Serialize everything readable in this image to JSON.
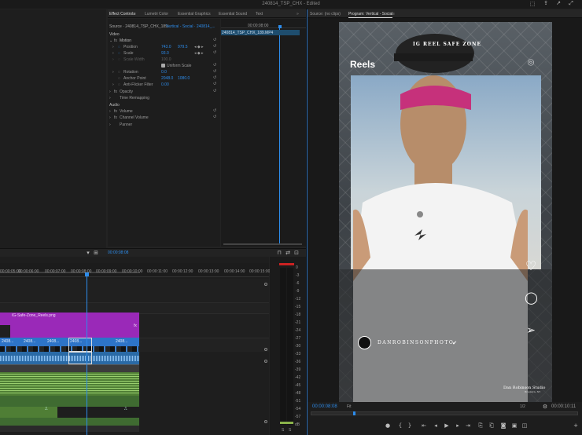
{
  "titlebar": {
    "title": "240814_TSP_CHX - Edited"
  },
  "tabs": [
    {
      "label": "Effect Controls",
      "active": true
    },
    {
      "label": "Lumetri Color"
    },
    {
      "label": "Essential Graphics"
    },
    {
      "label": "Essential Sound"
    },
    {
      "label": "Text"
    }
  ],
  "effect_controls": {
    "source_label": "Source · 240814_TSP_CHX_189...",
    "sequence_label": "Vertical - Social · 240814_...",
    "timecode_head": "00:00:08:00",
    "clip_bar_label": "240814_TSP_CHX_189.MP4",
    "video_header": "Video",
    "motion_label": "Motion",
    "position_label": "Position",
    "position_x": "743.0",
    "position_y": "979.5",
    "scale_label": "Scale",
    "scale_value": "93.0",
    "scale_width_label": "Scale Width",
    "scale_width_value": "100.0",
    "uniform_scale_label": "Uniform Scale",
    "rotation_label": "Rotation",
    "rotation_value": "0.0",
    "anchor_label": "Anchor Point",
    "anchor_x": "2048.0",
    "anchor_y": "1080.0",
    "antiflicker_label": "Anti-Flicker Filter",
    "antiflicker_value": "0.00",
    "opacity_label": "Opacity",
    "time_remap_label": "Time Remapping",
    "audio_header": "Audio",
    "volume_label": "Volume",
    "channel_volume_label": "Channel Volume",
    "panner_label": "Panner",
    "current_timecode": "00:00:08:08"
  },
  "timeline": {
    "ruler": [
      "00:00:05:00",
      "00:00:06:00",
      "00:00:07:00",
      "00:00:08:00",
      "00:00:09:00",
      "00:00:10:00",
      "00:00:11:00",
      "00:00:12:00",
      "00:00:13:00",
      "00:00:14:00",
      "00:00:15:00"
    ],
    "graphic_clip_label": "IG-Safe-Zone_Reels.png",
    "video_clips": [
      "2408...",
      "2408...",
      "2408...",
      "2408...",
      "2408..."
    ]
  },
  "meter": {
    "scale": [
      "0",
      "-3",
      "-6",
      "-9",
      "-12",
      "-15",
      "-18",
      "-21",
      "-24",
      "-27",
      "-30",
      "-33",
      "-36",
      "-39",
      "-42",
      "-45",
      "-48",
      "-51",
      "-54",
      "-57",
      "dB"
    ],
    "solo": [
      "S",
      "S"
    ]
  },
  "monitor": {
    "source_tab": "Source: (no clips)",
    "program_tab": "Program: Vertical - Social",
    "current_timecode": "00:00:08:08",
    "fit_label": "Fit",
    "quality_label": "1/2",
    "duration": "00:00:10:11"
  },
  "overlay": {
    "safe_zone_title": "IG REEL SAFE ZONE",
    "reels_label": "Reels",
    "username": "DANROBINSONPHOTO",
    "watermark_line1": "Dan Robinson Studio",
    "watermark_line2": "Brooklyn, NY"
  },
  "colors": {
    "accent": "#2d8ceb",
    "graphic_clip": "#9a29b8",
    "video_clip": "#2d74c8",
    "audio_clip": "#3f6b31",
    "panel": "#1e1e1e"
  }
}
